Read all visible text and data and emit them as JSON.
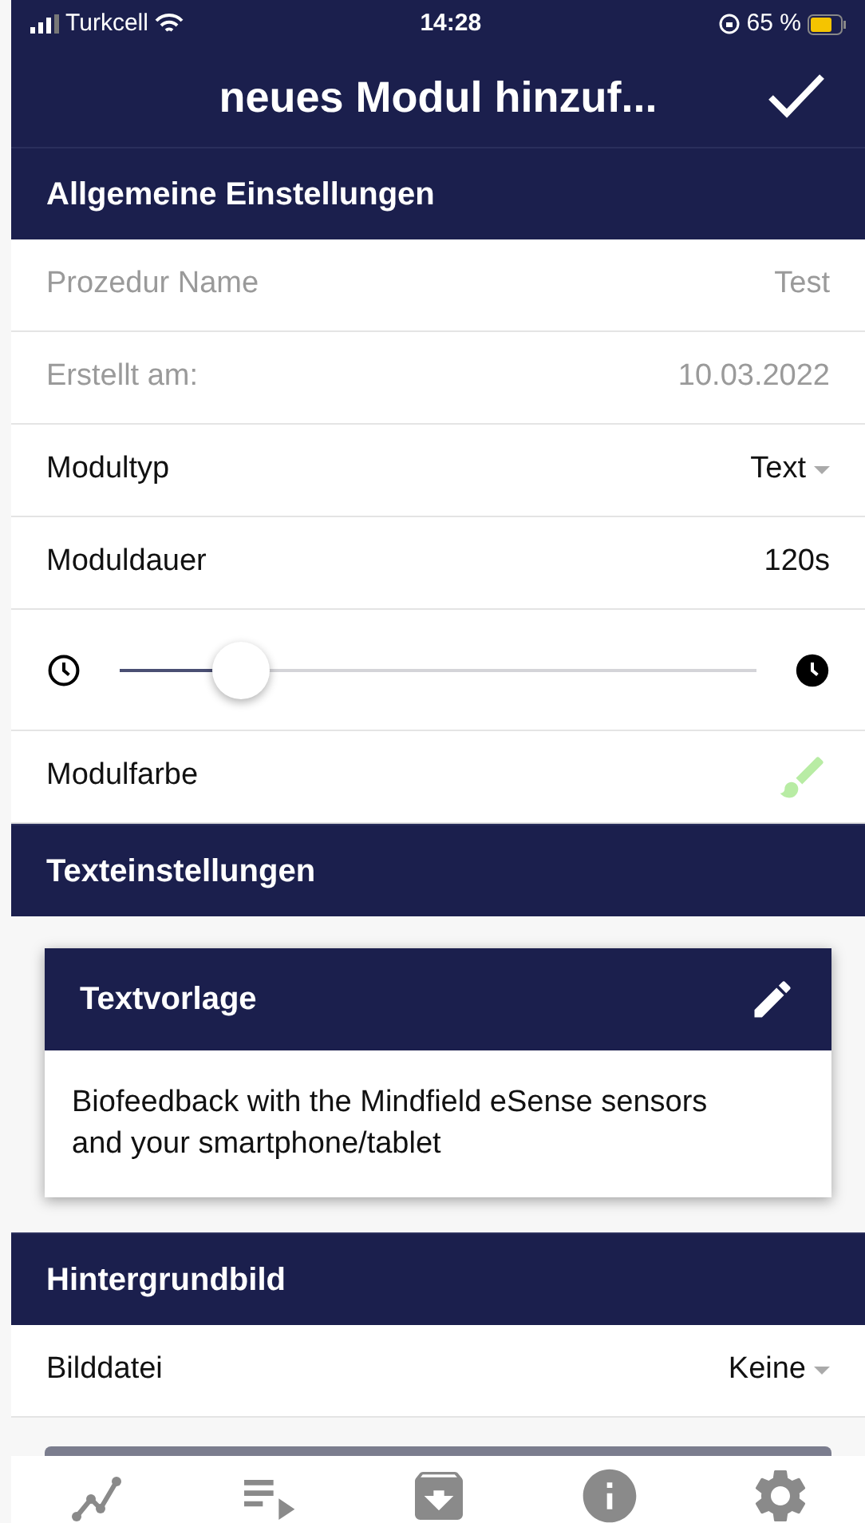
{
  "status_bar": {
    "carrier": "Turkcell",
    "time": "14:28",
    "battery": "65 %"
  },
  "header": {
    "title": "neues Modul hinzuf..."
  },
  "sections": [
    {
      "title": "Allgemeine Einstellungen",
      "rows": [
        {
          "kind": "text",
          "label": "Prozedur Name",
          "value": "Test",
          "disabled": true
        },
        {
          "kind": "text",
          "label": "Erstellt am:",
          "value": "10.03.2022",
          "disabled": true
        },
        {
          "kind": "dropdown",
          "label": "Modultyp",
          "value": "Text",
          "disabled": false
        },
        {
          "kind": "text",
          "label": "Moduldauer",
          "value": "120s",
          "disabled": false
        },
        {
          "kind": "slider",
          "level": 0.19
        },
        {
          "kind": "color",
          "label": "Modulfarbe",
          "color": "#b8eca4"
        }
      ]
    },
    {
      "title": "Texteinstellungen",
      "card": {
        "title": "Textvorlage",
        "body": "Biofeedback with the Mindfield eSense sensors and your smartphone/tablet"
      }
    },
    {
      "title": "Hintergrundbild",
      "rows": [
        {
          "kind": "dropdown",
          "label": "Bilddatei",
          "value": "Keine",
          "disabled": false
        }
      ]
    }
  ],
  "tab_bar": [
    {
      "kind": "chart"
    },
    {
      "kind": "playlist"
    },
    {
      "kind": "archive"
    },
    {
      "kind": "info"
    },
    {
      "kind": "settings"
    }
  ]
}
